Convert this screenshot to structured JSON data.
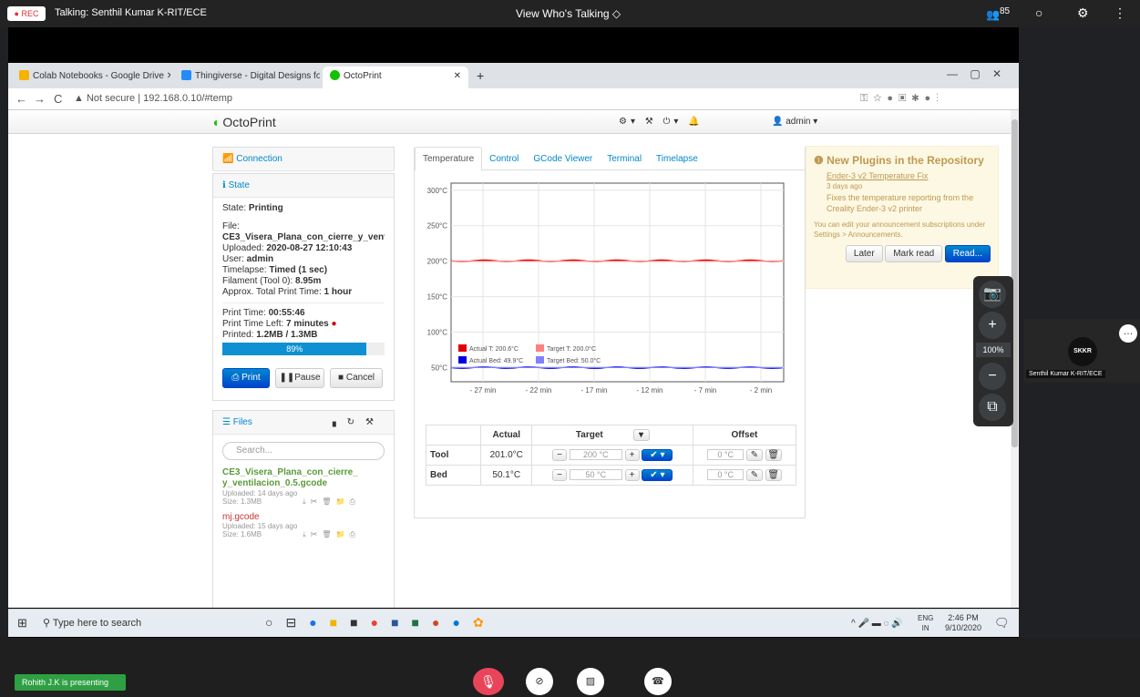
{
  "zoom": {
    "rec": "● REC",
    "talking": "Talking: Senthil Kumar K-RIT/ECE",
    "view_toggle": "View Who's Talking ◇",
    "participants": "85",
    "presenting": "Rohith J.K is presenting",
    "zoom_level": "100%",
    "participant_initials": "SKKR",
    "participant_name": "Senthil Kumar K-RIT/ECE"
  },
  "browser": {
    "tabs": [
      "Colab Notebooks - Google Drive",
      "Thingiverse - Digital Designs for",
      "OctoPrint"
    ],
    "url_prefix": "Not secure",
    "url": "192.168.0.10/#temp"
  },
  "octoprint": {
    "brand": "OctoPrint",
    "user": "admin",
    "connection": "Connection",
    "state_header": "State",
    "state_label": "State: ",
    "state_value": "Printing",
    "file_label": "File:",
    "file_name": "CE3_Visera_Plana_con_cierre_y_ventilacio",
    "uploaded_label": "Uploaded: ",
    "uploaded_value": "2020-08-27 12:10:43",
    "user_label": "User: ",
    "user_value": "admin",
    "timelapse_label": "Timelapse: ",
    "timelapse_value": "Timed (1 sec)",
    "filament_label": "Filament (Tool 0): ",
    "filament_value": "8.95m",
    "approx_label": "Approx. Total Print Time: ",
    "approx_value": "1 hour",
    "print_time_label": "Print Time: ",
    "print_time_value": "00:55:46",
    "time_left_label": "Print Time Left: ",
    "time_left_value": "7 minutes",
    "printed_label": "Printed: ",
    "printed_value": "1.2MB / 1.3MB",
    "progress_text": "89%",
    "progress": 0.89,
    "btn_print": "Print",
    "btn_pause": "Pause",
    "btn_cancel": "Cancel",
    "files_header": "Files",
    "search_placeholder": "Search...",
    "files": [
      {
        "name": "CE3_Visera_Plana_con_cierre_ y_ventilacion_0.5.gcode",
        "uploaded": "Uploaded: 14 days ago",
        "size": "Size: 1.3MB"
      },
      {
        "name": "mj.gcode",
        "uploaded": "Uploaded: 15 days ago",
        "size": "Size: 1.6MB"
      }
    ],
    "main_tabs": [
      "Temperature",
      "Control",
      "GCode Viewer",
      "Terminal",
      "Timelapse"
    ],
    "table": {
      "headers": [
        "Actual",
        "Target",
        "Offset"
      ],
      "rows": [
        {
          "name": "Tool",
          "actual": "201.0°C",
          "target": "200",
          "offset": "0"
        },
        {
          "name": "Bed",
          "actual": "50.1°C",
          "target": "50",
          "offset": "0"
        }
      ],
      "unit": "°C"
    },
    "notice": {
      "title": "New Plugins in the Repository",
      "plugin": "Ender-3 v2 Temperature Fix",
      "ago": "3 days ago",
      "desc": "Fixes the temperature reporting from the Creality Ender-3 v2 printer",
      "note": "You can edit your announcement subscriptions under Settings > Announcements.",
      "later": "Later",
      "mark": "Mark read",
      "read": "Read..."
    }
  },
  "chart_data": {
    "type": "line",
    "yticks": [
      "300°C",
      "250°C",
      "200°C",
      "150°C",
      "100°C",
      "50°C"
    ],
    "xticks": [
      "- 27 min",
      "- 22 min",
      "- 17 min",
      "- 12 min",
      "- 7 min",
      "- 2 min"
    ],
    "ylim": [
      30,
      310
    ],
    "series": [
      {
        "name": "Actual T: 200.6°C",
        "color": "#e00000",
        "value": 200.6
      },
      {
        "name": "Target T: 200.0°C",
        "color": "#ff8080",
        "value": 200.0
      },
      {
        "name": "Actual Bed: 49.9°C",
        "color": "#0000e0",
        "value": 49.9
      },
      {
        "name": "Target Bed: 50.0°C",
        "color": "#8080ff",
        "value": 50.0
      }
    ]
  },
  "taskbar": {
    "search": "Type here to search",
    "lang": "ENG",
    "region": "IN",
    "time": "2:46 PM",
    "date": "9/10/2020"
  }
}
